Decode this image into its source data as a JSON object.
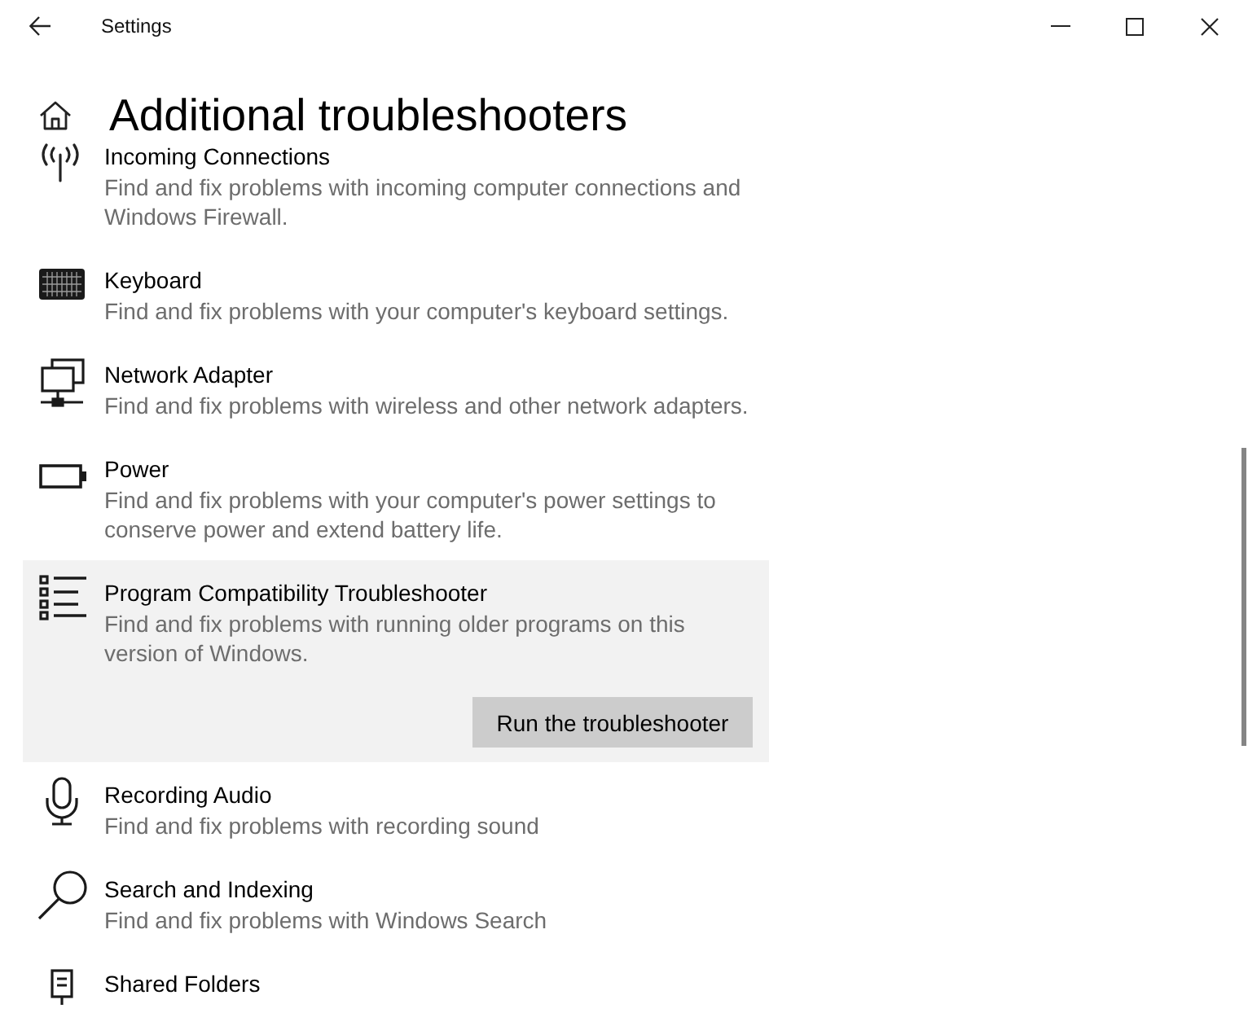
{
  "window": {
    "title": "Settings"
  },
  "page": {
    "title": "Additional troubleshooters"
  },
  "troubleshooters": [
    {
      "kind": "antenna",
      "title": "Incoming Connections",
      "description": "Find and fix problems with incoming computer connections and Windows Firewall.",
      "selected": false
    },
    {
      "kind": "keyboard",
      "title": "Keyboard",
      "description": "Find and fix problems with your computer's keyboard settings.",
      "selected": false
    },
    {
      "kind": "network",
      "title": "Network Adapter",
      "description": "Find and fix problems with wireless and other network adapters.",
      "selected": false
    },
    {
      "kind": "battery",
      "title": "Power",
      "description": "Find and fix problems with your computer's power settings to conserve power and extend battery life.",
      "selected": false
    },
    {
      "kind": "list",
      "title": "Program Compatibility Troubleshooter",
      "description": "Find and fix problems with running older programs on this version of Windows.",
      "selected": true,
      "button": "Run the troubleshooter"
    },
    {
      "kind": "microphone",
      "title": "Recording Audio",
      "description": "Find and fix problems with recording sound",
      "selected": false
    },
    {
      "kind": "search",
      "title": "Search and Indexing",
      "description": "Find and fix problems with Windows Search",
      "selected": false
    },
    {
      "kind": "server",
      "title": "Shared Folders",
      "selected": false
    }
  ]
}
